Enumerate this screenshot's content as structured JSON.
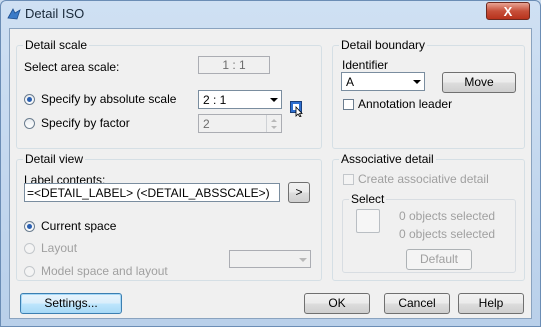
{
  "window": {
    "title": "Detail ISO",
    "close_label": "X"
  },
  "detail_scale": {
    "group_label": "Detail scale",
    "select_area_scale_label": "Select area scale:",
    "area_scale_value": "1 : 1",
    "absolute_option": "Specify by absolute scale",
    "absolute_value": "2 : 1",
    "factor_option": "Specify by factor",
    "factor_value": "2"
  },
  "detail_boundary": {
    "group_label": "Detail boundary",
    "identifier_label": "Identifier",
    "identifier_value": "A",
    "move_button": "Move",
    "annotation_leader_label": "Annotation leader"
  },
  "detail_view": {
    "group_label": "Detail view",
    "label_contents_label": "Label contents:",
    "label_contents_value": "=<DETAIL_LABEL> (<DETAIL_ABSSCALE>)",
    "insert_button": ">",
    "current_space": "Current space",
    "layout": "Layout",
    "model_space_and_layout": "Model space and layout"
  },
  "associative_detail": {
    "group_label": "Associative detail",
    "create_label": "Create associative detail",
    "select_label": "Select",
    "objects_selected_1": "0 objects selected",
    "objects_selected_2": "0 objects selected",
    "default_button": "Default"
  },
  "footer": {
    "settings": "Settings...",
    "ok": "OK",
    "cancel": "Cancel",
    "help": "Help"
  }
}
